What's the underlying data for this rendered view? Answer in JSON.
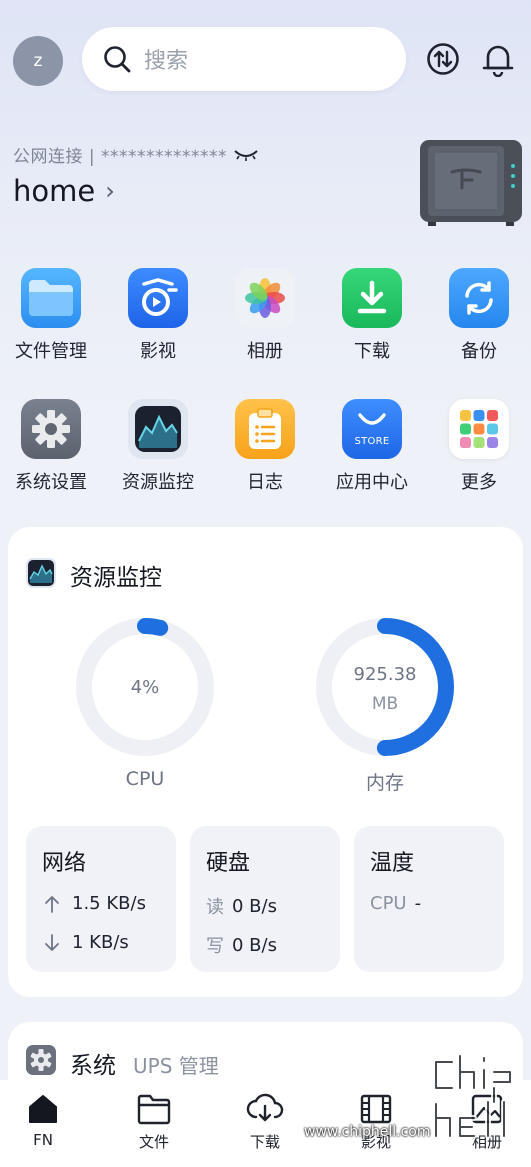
{
  "header": {
    "avatar_initial": "z",
    "search_placeholder": "搜索"
  },
  "nas": {
    "connection": "公网连接 | **************",
    "name": "home"
  },
  "apps": [
    {
      "label": "文件管理",
      "icon": "folder-icon"
    },
    {
      "label": "影视",
      "icon": "video-icon"
    },
    {
      "label": "相册",
      "icon": "photos-icon"
    },
    {
      "label": "下载",
      "icon": "download-icon"
    },
    {
      "label": "备份",
      "icon": "backup-icon"
    },
    {
      "label": "系统设置",
      "icon": "gear-icon"
    },
    {
      "label": "资源监控",
      "icon": "monitor-icon"
    },
    {
      "label": "日志",
      "icon": "log-icon"
    },
    {
      "label": "应用中心",
      "icon": "store-icon"
    },
    {
      "label": "更多",
      "icon": "more-grid-icon"
    }
  ],
  "store_icon_text": "STORE",
  "monitor": {
    "title": "资源监控",
    "cpu": {
      "value_text": "4%",
      "label": "CPU",
      "fraction": 0.04
    },
    "memory": {
      "value": "925.38",
      "unit": "MB",
      "label": "内存",
      "fraction": 0.5
    },
    "network": {
      "title": "网络",
      "up": "1.5 KB/s",
      "down": "1 KB/s"
    },
    "disk": {
      "title": "硬盘",
      "read_label": "读",
      "read": "0 B/s",
      "write_label": "写",
      "write": "0 B/s"
    },
    "temperature": {
      "title": "温度",
      "cpu_label": "CPU",
      "cpu_value": "-"
    }
  },
  "system": {
    "title": "系统",
    "ups": "UPS 管理"
  },
  "tabs": [
    {
      "label": "FN"
    },
    {
      "label": "文件"
    },
    {
      "label": "下载"
    },
    {
      "label": "影视"
    },
    {
      "label": "相册"
    }
  ],
  "watermark": "www.chiphell.com",
  "colors": {
    "accent": "#1f6fe0",
    "ring_track": "#eef0f5"
  }
}
